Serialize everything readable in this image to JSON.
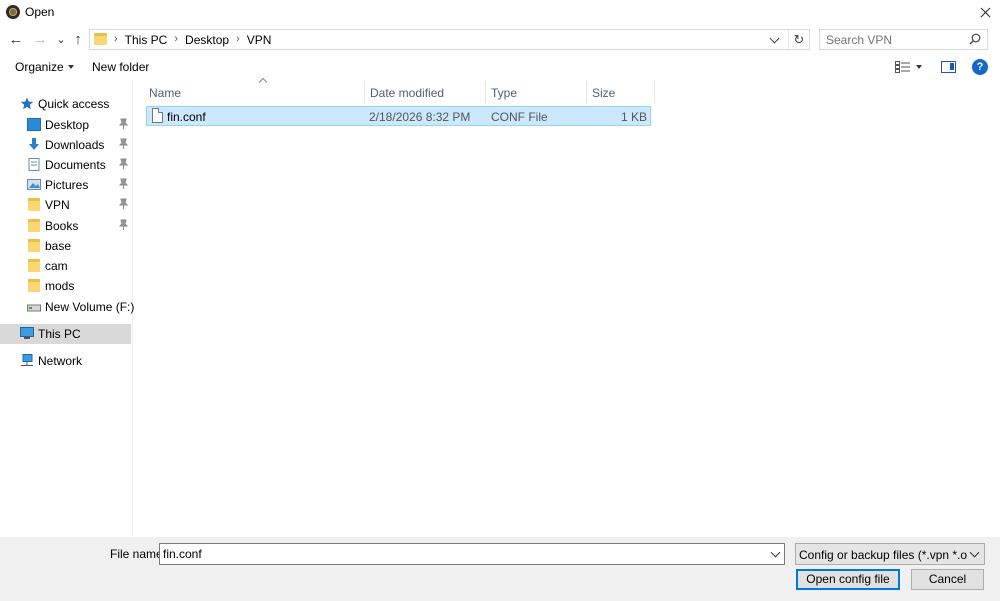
{
  "window": {
    "title": "Open"
  },
  "nav": {
    "breadcrumbs": [
      "This PC",
      "Desktop",
      "VPN"
    ],
    "search_placeholder": "Search VPN",
    "refresh_glyph": "↻",
    "back_glyph": "←",
    "forward_glyph": "→",
    "recent_glyph": "⌄",
    "up_glyph": "↑"
  },
  "toolbar": {
    "organize": "Organize",
    "new_folder": "New folder",
    "help": "?"
  },
  "sidebar": {
    "items": [
      {
        "label": "Quick access",
        "icon": "star-icon"
      },
      {
        "label": "Desktop",
        "icon": "desktop-icon",
        "pinned": true
      },
      {
        "label": "Downloads",
        "icon": "downloads-icon",
        "pinned": true
      },
      {
        "label": "Documents",
        "icon": "documents-icon",
        "pinned": true
      },
      {
        "label": "Pictures",
        "icon": "pictures-icon",
        "pinned": true
      },
      {
        "label": "VPN",
        "icon": "folder-icon",
        "pinned": true
      },
      {
        "label": "Books",
        "icon": "folder-icon",
        "pinned": true
      },
      {
        "label": "base",
        "icon": "folder-icon"
      },
      {
        "label": "cam",
        "icon": "folder-icon"
      },
      {
        "label": "mods",
        "icon": "folder-icon"
      },
      {
        "label": "New Volume (F:)",
        "icon": "drive-icon"
      },
      {
        "label": "This PC",
        "icon": "computer-icon",
        "selected": true
      },
      {
        "label": "Network",
        "icon": "network-icon"
      }
    ]
  },
  "filelist": {
    "columns": [
      "Name",
      "Date modified",
      "Type",
      "Size"
    ],
    "rows": [
      {
        "name": "fin.conf",
        "date": "2/18/2026 8:32 PM",
        "type": "CONF File",
        "size": "1 KB"
      }
    ]
  },
  "footer": {
    "filename_label": "File name:",
    "filename_value": "fin.conf",
    "filter_label": "Config or backup files (*.vpn *.ovpn *.",
    "open_button": "Open config file",
    "cancel_button": "Cancel"
  },
  "colors": {
    "selection": "#cce8ff",
    "accent": "#0078d7",
    "folder": "#f9d874"
  }
}
